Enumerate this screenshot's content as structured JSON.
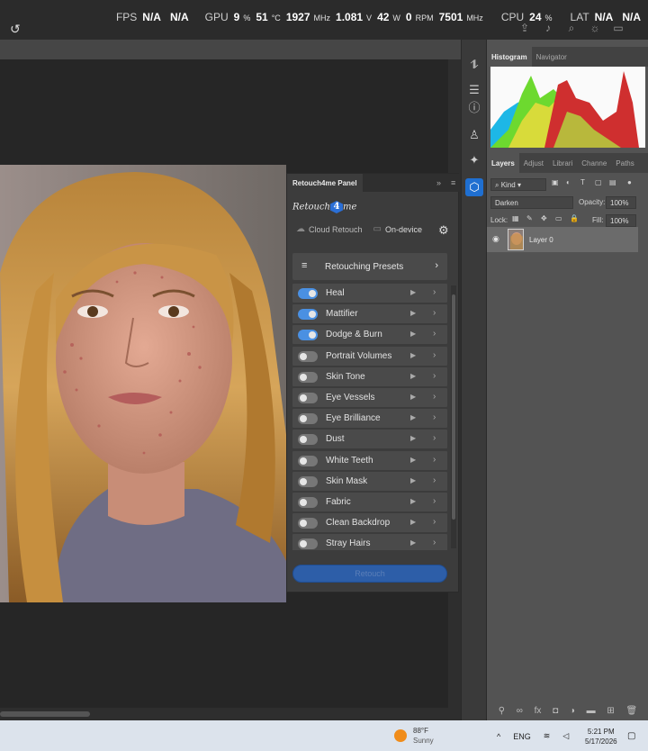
{
  "osd": {
    "fps_label": "FPS",
    "fps_value1": "N/A",
    "fps_value2": "N/A",
    "gpu_label": "GPU",
    "gpu_load": "9",
    "gpu_load_unit": "%",
    "gpu_temp": "51",
    "gpu_temp_unit": "°C",
    "gpu_clock": "1927",
    "gpu_clock_unit": "MHz",
    "gpu_volt": "1.081",
    "gpu_volt_unit": "V",
    "gpu_power": "42",
    "gpu_power_unit": "W",
    "gpu_fan": "0",
    "gpu_fan_unit": "RPM",
    "gpu_mem": "7501",
    "gpu_mem_unit": "MHz",
    "cpu_label": "CPU",
    "cpu_load": "24",
    "cpu_load_unit": "%",
    "lat_label": "LAT",
    "lat_value1": "N/A",
    "lat_value2": "N/A"
  },
  "panels": {
    "top_tabs": [
      "Histogram",
      "Navigator"
    ],
    "layers_tabs": [
      "Layers",
      "Adjust",
      "Librari",
      "Channe",
      "Paths"
    ],
    "kind_filter": "Kind",
    "blend_mode": "Darken",
    "opacity_label": "Opacity:",
    "opacity_value": "100%",
    "lock_label": "Lock:",
    "fill_label": "Fill:",
    "fill_value": "100%",
    "layer_name": "Layer 0"
  },
  "retouch": {
    "tab_title": "Retouch4me Panel",
    "logo_left": "Retouch",
    "logo_mark": "4",
    "logo_right": "me",
    "cloud_label": "Cloud Retouch",
    "ondevice_label": "On-device",
    "presets_label": "Retouching Presets",
    "retouch_button": "Retouch",
    "plugins": [
      {
        "name": "Heal",
        "on": true
      },
      {
        "name": "Mattifier",
        "on": true
      },
      {
        "name": "Dodge & Burn",
        "on": true
      },
      {
        "name": "Portrait Volumes",
        "on": false
      },
      {
        "name": "Skin Tone",
        "on": false
      },
      {
        "name": "Eye Vessels",
        "on": false
      },
      {
        "name": "Eye Brilliance",
        "on": false
      },
      {
        "name": "Dust",
        "on": false
      },
      {
        "name": "White Teeth",
        "on": false
      },
      {
        "name": "Skin Mask",
        "on": false
      },
      {
        "name": "Fabric",
        "on": false
      },
      {
        "name": "Clean Backdrop",
        "on": false
      },
      {
        "name": "Stray Hairs",
        "on": false
      }
    ]
  },
  "taskbar": {
    "temp": "88°F",
    "condition": "Sunny",
    "language": "ENG",
    "time": "5:21 PM",
    "date": "5/17/2026"
  },
  "colors": {
    "accent": "#1f6fd1",
    "toggle_on": "#4a90e2",
    "retouch_button": "#2d5ea8"
  }
}
